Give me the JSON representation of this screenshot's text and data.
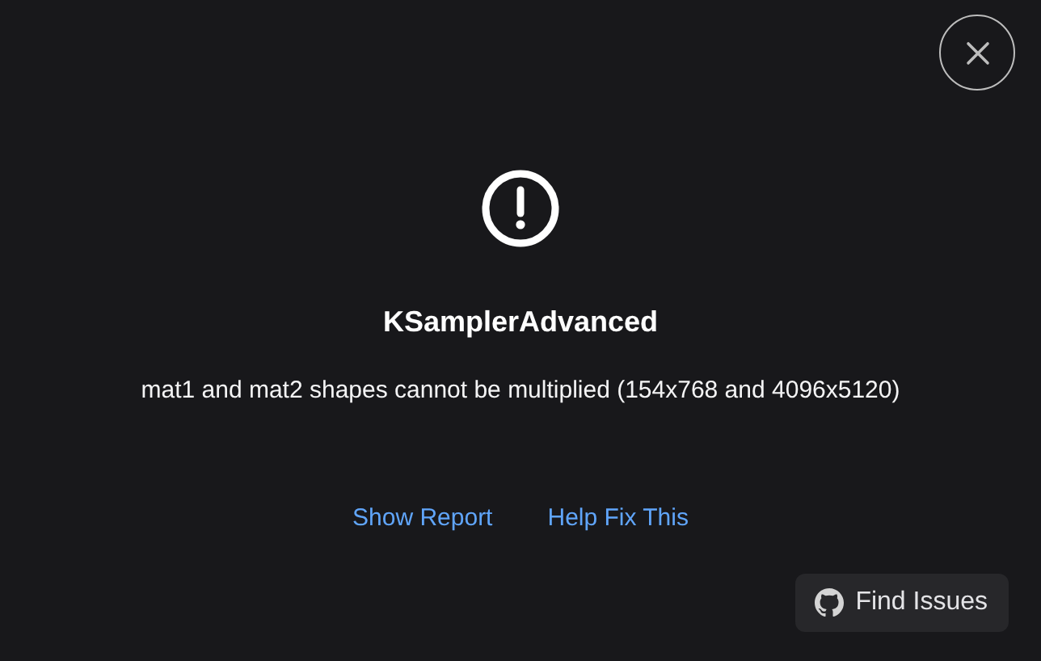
{
  "dialog": {
    "title": "KSamplerAdvanced",
    "message": "mat1 and mat2 shapes cannot be multiplied (154x768 and 4096x5120)",
    "links": [
      "Show Report",
      "Help Fix This"
    ],
    "footer_button": {
      "label": "Find Issues"
    }
  }
}
